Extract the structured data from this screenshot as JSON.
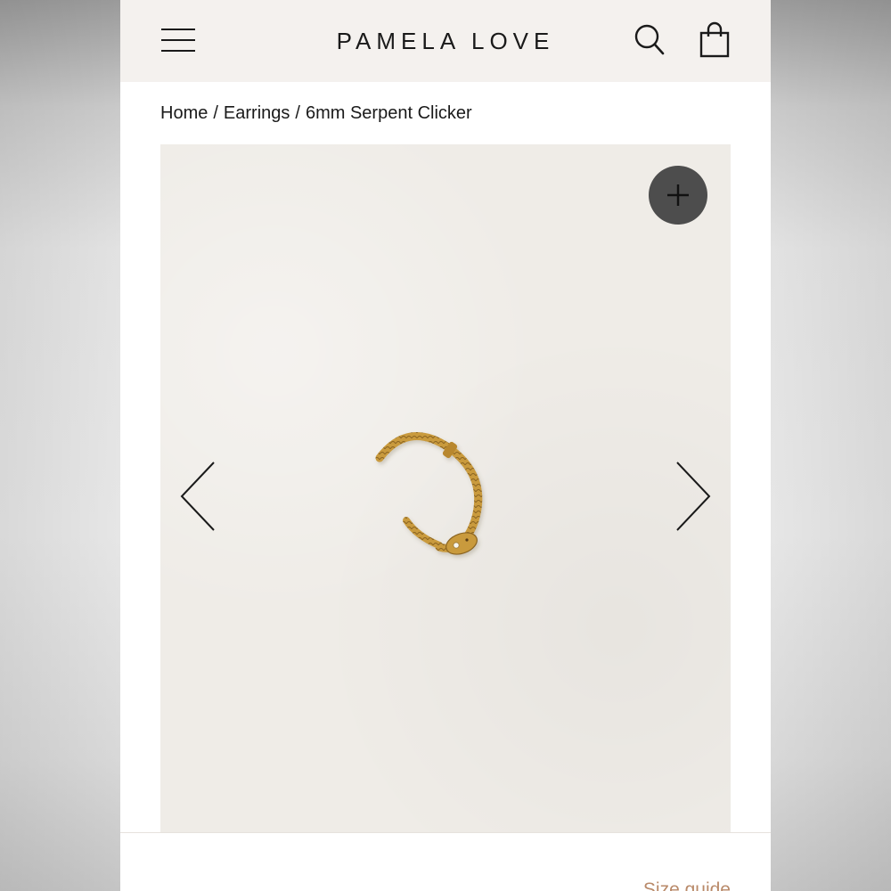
{
  "header": {
    "brand": "PAMELA LOVE",
    "menu_icon": "hamburger-menu-icon",
    "search_icon": "search-icon",
    "bag_icon": "shopping-bag-icon"
  },
  "breadcrumb": {
    "items": [
      "Home",
      "Earrings",
      "6mm Serpent Clicker"
    ],
    "separator": "/"
  },
  "gallery": {
    "zoom_icon": "plus-icon",
    "prev_icon": "chevron-left-icon",
    "next_icon": "chevron-right-icon",
    "image": "gold-serpent-clicker-earring"
  },
  "footer": {
    "size_guide_label": "Size guide"
  },
  "colors": {
    "header_bg": "#f4f1ee",
    "zoom_button": "#4d4d4d",
    "size_guide_link": "#b98a6a",
    "gold": "#c99a3c"
  }
}
